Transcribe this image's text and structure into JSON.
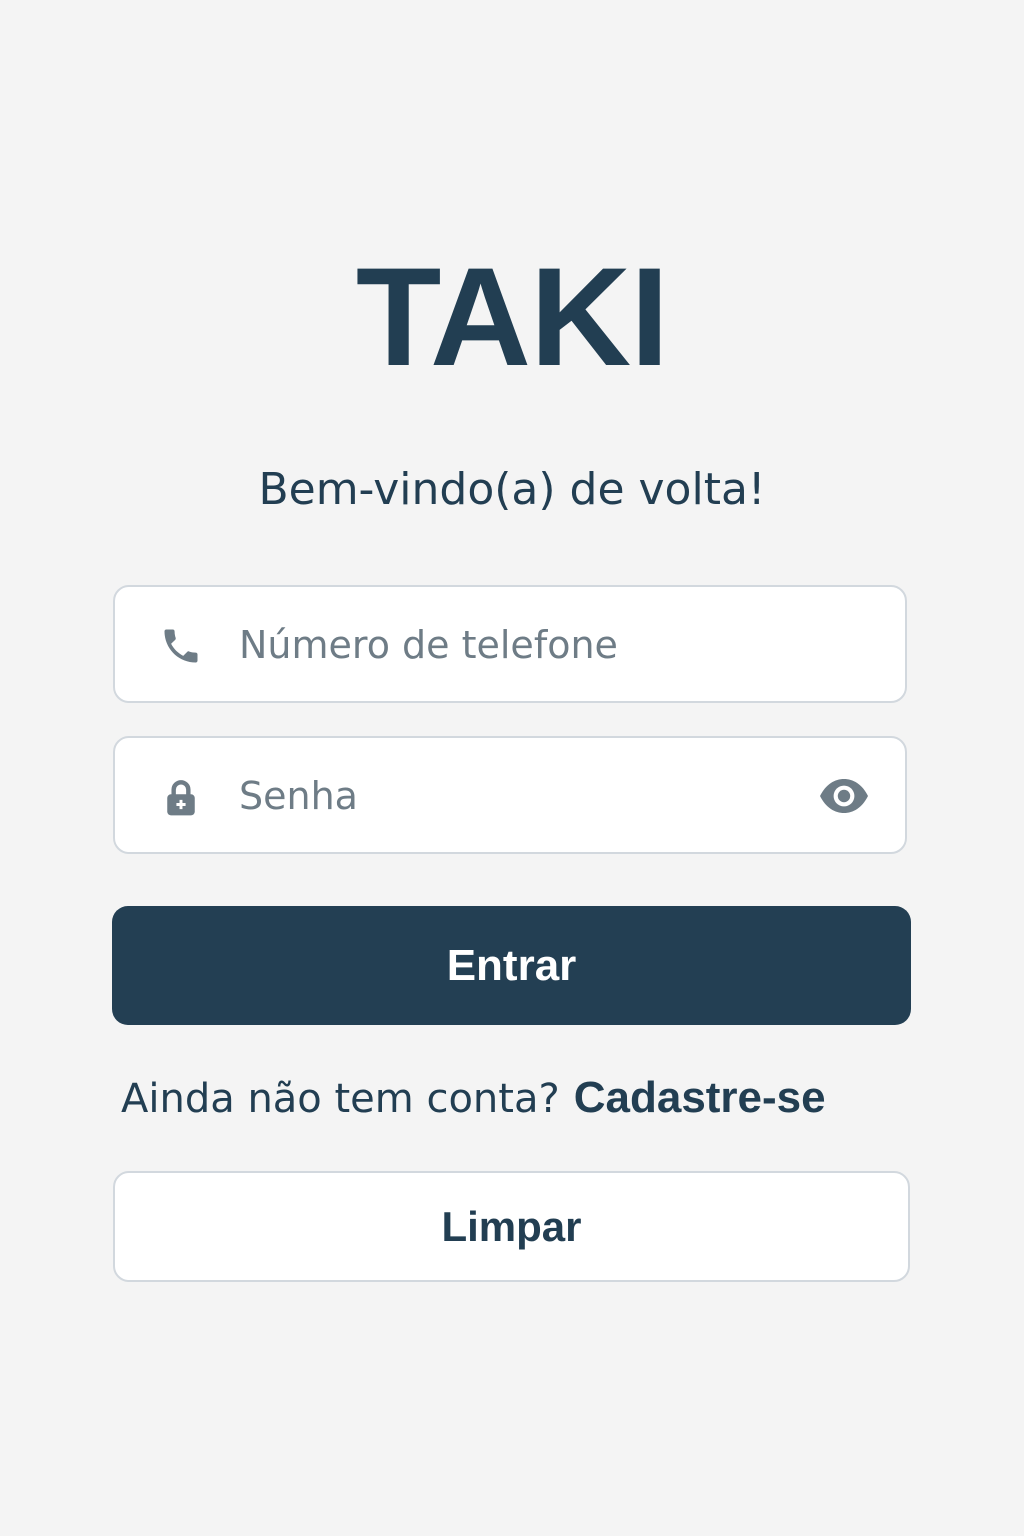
{
  "app": {
    "logo_text": "TAKI",
    "welcome": "Bem-vindo(a) de volta!"
  },
  "form": {
    "phone": {
      "icon": "phone-icon",
      "placeholder": "Número de telefone",
      "value": ""
    },
    "password": {
      "icon": "lock-icon",
      "placeholder": "Senha",
      "value": "",
      "toggle_icon": "eye-icon"
    },
    "submit_label": "Entrar",
    "signup_prompt": "Ainda não tem conta?",
    "signup_link": "Cadastre-se",
    "clear_label": "Limpar"
  },
  "colors": {
    "background": "#f4f4f4",
    "brand": "#223e52",
    "input_border": "#d2d8de",
    "placeholder": "#6e7c86",
    "icon": "#6e7c86"
  }
}
